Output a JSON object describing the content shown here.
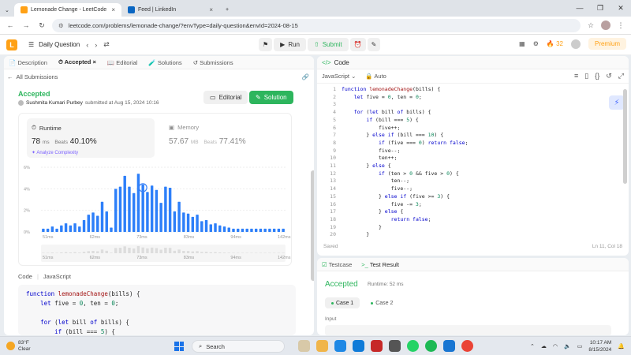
{
  "browser": {
    "tabs": [
      {
        "title": "Lemonade Change - LeetCode",
        "active": true,
        "color": "#ffa116"
      },
      {
        "title": "Feed | LinkedIn",
        "active": false,
        "color": "#0a66c2"
      }
    ],
    "new_tab": "+",
    "url": "leetcode.com/problems/lemonade-change/?envType=daily-question&envId=2024-08-15"
  },
  "header": {
    "daily_question": "Daily Question",
    "run": "Run",
    "submit": "Submit",
    "streak": "32",
    "premium": "Premium"
  },
  "left": {
    "tabs": [
      "Description",
      "Accepted",
      "Editorial",
      "Solutions",
      "Submissions"
    ],
    "all_submissions": "All Submissions",
    "status": "Accepted",
    "author": "Sushmita Kumari Purbey",
    "submitted_text": "submitted at Aug 15, 2024 10:16",
    "editorial_btn": "Editorial",
    "solution_btn": "Solution",
    "runtime_label": "Runtime",
    "runtime_value": "78",
    "runtime_unit": "ms",
    "beats_label": "Beats",
    "runtime_pct": "40.10%",
    "analyze": "Analyze Complexity",
    "memory_label": "Memory",
    "memory_value": "57.67",
    "memory_unit": "MB",
    "memory_pct": "77.41%",
    "code_label": "Code",
    "language": "JavaScript",
    "code_lines": [
      "function lemonadeChange(bills) {",
      "    let five = 0, ten = 0;",
      "",
      "    for (let bill of bills) {",
      "        if (bill === 5) {"
    ]
  },
  "chart_data": {
    "type": "bar",
    "ylabel_ticks": [
      "0%",
      "2%",
      "4%",
      "6%"
    ],
    "xlabel_ticks": [
      "51ms",
      "62ms",
      "73ms",
      "83ms",
      "94ms",
      "142ms"
    ],
    "ylim": [
      0,
      6
    ],
    "values": [
      0.3,
      0.3,
      0.5,
      0.3,
      0.6,
      0.8,
      0.6,
      0.8,
      0.5,
      1.1,
      1.6,
      1.8,
      1.5,
      2.8,
      1.9,
      0.4,
      4.0,
      4.2,
      5.2,
      4.2,
      3.6,
      5.4,
      4.4,
      3.7,
      4.3,
      3.9,
      2.7,
      4.2,
      4.1,
      1.9,
      2.8,
      1.8,
      1.7,
      1.4,
      1.6,
      1.0,
      1.1,
      0.7,
      0.8,
      0.6,
      0.5,
      0.4,
      0.3,
      0.3,
      0.3,
      0.3,
      0.3,
      0.3,
      0.3,
      0.3,
      0.3,
      0.3,
      0.3,
      0.3
    ],
    "highlight_index": 22,
    "bar_color": "#2d7ff9"
  },
  "right": {
    "tab": "Code",
    "language": "JavaScript",
    "auto": "Auto",
    "code": [
      "function lemonadeChange(bills) {",
      "    let five = 0, ten = 0;",
      "",
      "    for (let bill of bills) {",
      "        if (bill === 5) {",
      "            five++;",
      "        } else if (bill === 10) {",
      "            if (five === 0) return false;",
      "            five--;",
      "            ten++;",
      "        } else {",
      "            if (ten > 0 && five > 0) {",
      "                ten--;",
      "                five--;",
      "            } else if (five >= 3) {",
      "                five -= 3;",
      "            } else {",
      "                return false;",
      "            }",
      "        }"
    ],
    "saved": "Saved",
    "cursor": "Ln 11, Col 18"
  },
  "bottom": {
    "testcase": "Testcase",
    "test_result": "Test Result",
    "status": "Accepted",
    "runtime": "Runtime: 52 ms",
    "case1": "Case 1",
    "case2": "Case 2",
    "input_label": "Input"
  },
  "taskbar": {
    "temp": "83°F",
    "cond": "Clear",
    "search": "Search",
    "time": "10:17 AM",
    "date": "8/15/2024"
  }
}
